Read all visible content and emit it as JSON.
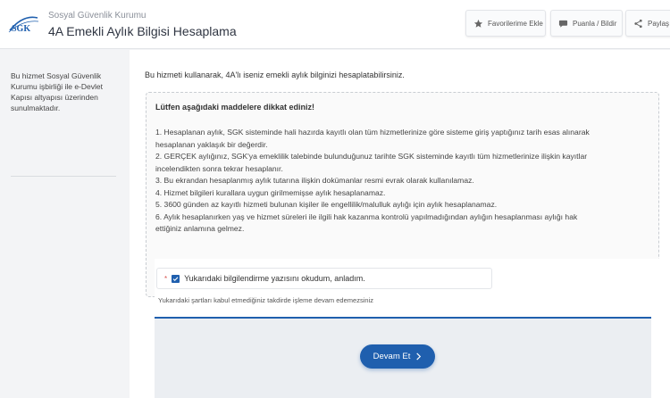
{
  "header": {
    "logo_text": "SGK",
    "org_name": "Sosyal Güvenlik Kurumu",
    "title": "4A Emekli Aylık Bilgisi Hesaplama",
    "buttons": {
      "favorites": "Favorilerime Ekle",
      "rate": "Puanla / Bildir",
      "share": "Paylaş"
    }
  },
  "sidebar": {
    "note": "Bu hizmet Sosyal Güvenlik Kurumu işbirliği ile e-Devlet Kapısı altyapısı üzerinden sunulmaktadır."
  },
  "main": {
    "intro": "Bu hizmeti kullanarak, 4A'lı iseniz emekli aylık bilginizi hesaplatabilirsiniz.",
    "notice": {
      "title": "Lütfen aşağıdaki maddelere dikkat ediniz!",
      "items": [
        "1. Hesaplanan aylık, SGK sisteminde hali hazırda kayıtlı olan tüm hizmetlerinize göre sisteme giriş yaptığınız tarih esas alınarak",
        "hesaplanan yaklaşık bir değerdir.",
        "2. GERÇEK aylığınız, SGK'ya emeklilik talebinde bulunduğunuz tarihte SGK sisteminde kayıtlı tüm hizmetlerinize ilişkin kayıtlar",
        "incelendikten sonra tekrar hesaplanır.",
        "3. Bu ekrandan hesaplanmış aylık tutarına ilişkin dokümanlar resmi evrak olarak kullanılamaz.",
        "4. Hizmet bilgileri kurallara uygun girilmemişse aylık hesaplanamaz.",
        "5. 3600 günden az kayıtlı hizmeti bulunan kişiler ile engellilik/malulluk aylığı için aylık hesaplanamaz.",
        "6. Aylık hesaplanırken yaş ve hizmet süreleri ile ilgili hak kazanma kontrolü yapılmadığından aylığın hesaplanması aylığı hak",
        "ettiğiniz anlamına gelmez."
      ]
    },
    "confirm": {
      "required_mark": "*",
      "checked": true,
      "checkbox_label": "Yukarıdaki bilgilendirme yazısını okudum, anladım.",
      "warning": "Yukarıdaki şartları kabul etmediğiniz takdirde işleme devam edemezsiniz"
    },
    "continue_button": "Devam Et"
  },
  "colors": {
    "primary": "#1f5fae",
    "header_bg": "#ffffff",
    "page_bg": "#f3f4f6",
    "notice_bg": "#fafafa",
    "action_bg": "#ebeef2"
  },
  "icons": {
    "logo": "sgk-logo",
    "favorites": "star-icon",
    "rate": "speech-bubble-icon",
    "share": "share-icon",
    "check": "check-icon",
    "continue": "chevron-right-icon"
  }
}
